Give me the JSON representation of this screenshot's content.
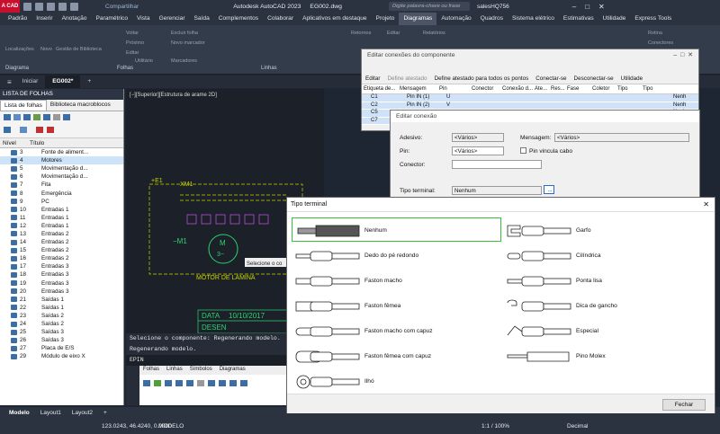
{
  "app": {
    "title": "Autodesk AutoCAD 2023",
    "file": "EG002.dwg",
    "share": "Compartilhar",
    "search_placeholder": "Digite palavra-chave ou frase",
    "user": "salesHQ756"
  },
  "menu": [
    "Padrão",
    "Inserir",
    "Anotação",
    "Paramétrico",
    "Vista",
    "Gerenciar",
    "Saída",
    "Complementos",
    "Colaborar",
    "Aplicativos em destaque",
    "Projeto",
    "Diagramas",
    "Automação",
    "Quadros",
    "Sistema elétrico",
    "Estimativas",
    "Utilidade",
    "Express Tools"
  ],
  "ribbon": {
    "items": [
      "Localizações",
      "Novo",
      "Gestão de Biblioteca",
      "Voltar",
      "Próximo",
      "Editar",
      "Excluir folha",
      "Novo marcador",
      "Utilitário",
      "Marcadores",
      "Linhas",
      "Retornos",
      "Editar",
      "Relatórios",
      "Rotina",
      "Conectores"
    ],
    "groups": [
      "Diagrama",
      "Folhas",
      "Linhas"
    ]
  },
  "doc_tabs": [
    "Iniciar",
    "EG002*",
    "+"
  ],
  "sheet_panel": {
    "header": "LISTA DE FOLHAS",
    "tabs": [
      "Lista de folhas",
      "Biblioteca macroblocos"
    ],
    "col_level": "Nível",
    "col_title": "Título",
    "rows": [
      [
        "3",
        "Fonte de aliment..."
      ],
      [
        "4",
        "Motores"
      ],
      [
        "5",
        "Movimentação d..."
      ],
      [
        "6",
        "Movimentação d..."
      ],
      [
        "7",
        "Fita"
      ],
      [
        "8",
        "Emergência"
      ],
      [
        "9",
        "PC"
      ],
      [
        "10",
        "Entradas 1"
      ],
      [
        "11",
        "Entradas 1"
      ],
      [
        "12",
        "Entradas 1"
      ],
      [
        "13",
        "Entradas 2"
      ],
      [
        "14",
        "Entradas 2"
      ],
      [
        "15",
        "Entradas 2"
      ],
      [
        "16",
        "Entradas 2"
      ],
      [
        "17",
        "Entradas 3"
      ],
      [
        "18",
        "Entradas 3"
      ],
      [
        "19",
        "Entradas 3"
      ],
      [
        "20",
        "Entradas 3"
      ],
      [
        "21",
        "Saídas 1"
      ],
      [
        "22",
        "Saídas 1"
      ],
      [
        "23",
        "Saídas 2"
      ],
      [
        "24",
        "Saídas 2"
      ],
      [
        "25",
        "Saídas 3"
      ],
      [
        "26",
        "Saídas 3"
      ],
      [
        "27",
        "Placa de E/S"
      ],
      [
        "29",
        "Módulo de eixo X"
      ]
    ]
  },
  "canvas": {
    "viewport": "[−][Superior][Estrutura de arame 2D]",
    "labels": [
      "+E1",
      "XM1",
      "−M1",
      "M",
      "3~",
      "MOTOR DE LÂMINA",
      "DATA",
      "10/10/2017",
      "DESEN",
      "Selecione o co"
    ]
  },
  "command": {
    "line1": "Selecione o componente: Regenerando modelo.",
    "line2": "Regenerando modelo.",
    "prompt": "EPIN"
  },
  "mini_panel": {
    "tabs": [
      "Folhas",
      "Linhas",
      "Símbolos",
      "Diagramas"
    ]
  },
  "layout_tabs": [
    "Modelo",
    "Layout1",
    "Layout2",
    "+"
  ],
  "status": {
    "coords": "123.0243, 46.4240, 0.0000",
    "mode": "MODELO",
    "scale": "1:1 / 100%",
    "units": "Decimal"
  },
  "edit_conn": {
    "title": "Editar conexões do componente",
    "buttons": [
      "Editar",
      "Define atestado",
      "Define atestado para todos os pontos",
      "Conectar-se",
      "Desconectar-se",
      "Utilidade"
    ],
    "cols": [
      "Etiqueta de...",
      "Mensagem",
      "Pin",
      "Conector",
      "Conexão d...",
      "Ate...",
      "Res...",
      "Fase",
      "Coletor",
      "Tipo",
      "Tipo"
    ],
    "rows": [
      [
        "C1",
        "Pin IN (1)",
        "U",
        "Nenh"
      ],
      [
        "C2",
        "Pin IN (2)",
        "V",
        "Nenh"
      ],
      [
        "C5",
        "",
        "",
        "Nenh"
      ],
      [
        "C7",
        "",
        "",
        "Nenh"
      ]
    ]
  },
  "edit_connection": {
    "title": "Editar conexão",
    "adesivo_label": "Adesivo:",
    "adesivo": "<Vários>",
    "mensagem_label": "Mensagem:",
    "mensagem": "<Vários>",
    "pin_label": "Pin:",
    "pin": "<Vários>",
    "pin_check": "Pin vincula cabo",
    "conector_label": "Conector:",
    "tipo_label": "Tipo terminal:",
    "tipo": "Nenhum",
    "more": "..."
  },
  "terminal": {
    "title": "Tipo terminal",
    "close_label": "Fechar",
    "left": [
      "Nenhum",
      "Dedo do pé redondo",
      "Faston macho",
      "Faston fêmea",
      "Faston macho com capuz",
      "Faston fêmea com capuz",
      "Ilhó"
    ],
    "right": [
      "Garfo",
      "Cilíndrica",
      "Ponta lisa",
      "Dica de gancho",
      "Especial",
      "Pino Molex"
    ]
  }
}
